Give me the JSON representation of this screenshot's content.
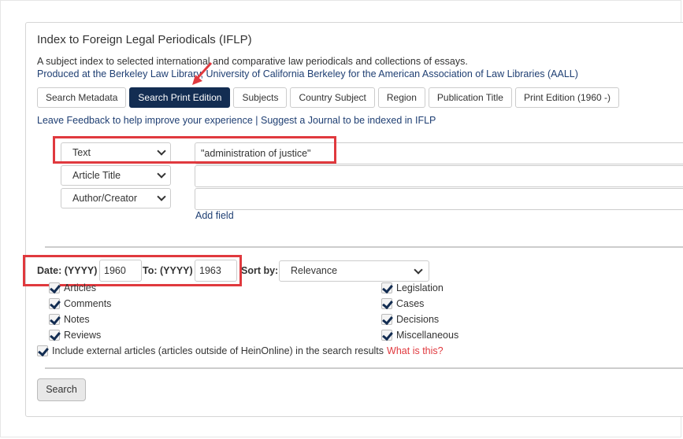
{
  "header": {
    "title": "Index to Foreign Legal Periodicals (IFLP)",
    "description_line1": "A subject index to selected international and comparative law periodicals and collections of essays.",
    "description_line2": "Produced at the Berkeley Law Library, University of California Berkeley for the American Association of Law Libraries (AALL)"
  },
  "tabs": [
    {
      "label": "Search Metadata",
      "active": false
    },
    {
      "label": "Search Print Edition",
      "active": true
    },
    {
      "label": "Subjects",
      "active": false
    },
    {
      "label": "Country Subject",
      "active": false
    },
    {
      "label": "Region",
      "active": false
    },
    {
      "label": "Publication Title",
      "active": false
    },
    {
      "label": "Print Edition (1960 -)",
      "active": false
    }
  ],
  "links": {
    "feedback": "Leave Feedback to help improve your experience",
    "separator": "|",
    "suggest": "Suggest a Journal to be indexed in IFLP"
  },
  "search_fields": [
    {
      "field": "Text",
      "value": "\"administration of justice\""
    },
    {
      "field": "Article Title",
      "value": ""
    },
    {
      "field": "Author/Creator",
      "value": ""
    }
  ],
  "add_field_label": "Add field",
  "date": {
    "from_label": "Date: (YYYY)",
    "from_value": "1960",
    "to_label": "To: (YYYY)",
    "to_value": "1963"
  },
  "sort": {
    "label": "Sort by:",
    "value": "Relevance"
  },
  "checkboxes_left": [
    {
      "label": "Articles",
      "checked": true
    },
    {
      "label": "Comments",
      "checked": true
    },
    {
      "label": "Notes",
      "checked": true
    },
    {
      "label": "Reviews",
      "checked": true
    }
  ],
  "checkboxes_right": [
    {
      "label": "Legislation",
      "checked": true
    },
    {
      "label": "Cases",
      "checked": true
    },
    {
      "label": "Decisions",
      "checked": true
    },
    {
      "label": "Miscellaneous",
      "checked": true
    }
  ],
  "external": {
    "label": "Include external articles (articles outside of HeinOnline) in the search results",
    "checked": true,
    "help_link": "What is this?"
  },
  "search_button": "Search",
  "colors": {
    "accent_navy": "#132d52",
    "link_blue": "#1f3f73",
    "highlight_red": "#e0393e"
  }
}
